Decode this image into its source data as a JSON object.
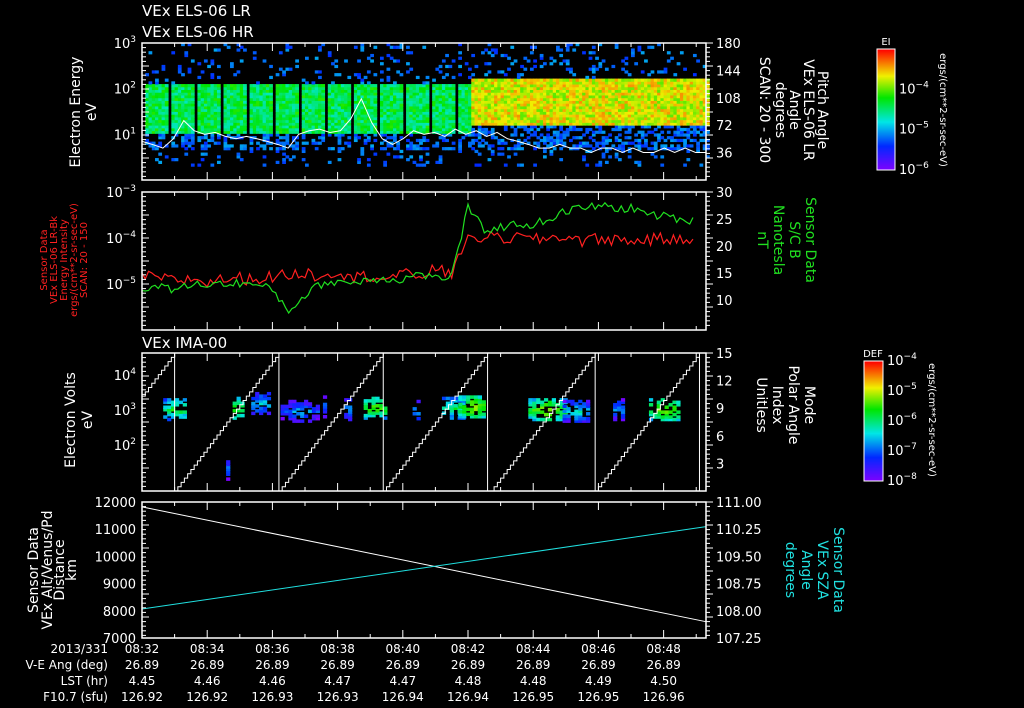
{
  "titles": [
    "VEx ELS-06 LR",
    "VEx ELS-06 HR"
  ],
  "chart_data": [
    {
      "type": "heatmap",
      "name": "ELS electron spectrogram",
      "ylabel_lines": [
        "Electron Energy",
        "eV"
      ],
      "y_scale": "log",
      "ylim": [
        1,
        1000
      ],
      "y_tick_exponents": [
        1,
        2,
        3
      ],
      "right_axis": {
        "label_lines": [
          "Pitch Angle",
          "VEx ELS-06 LR",
          "Angle",
          "degrees",
          "SCAN: 20 - 300"
        ],
        "ylim": [
          0,
          180
        ],
        "ticks": [
          "36",
          "72",
          "108",
          "144",
          "180"
        ]
      },
      "colorbar": {
        "title": "EI",
        "units": "ergs/(cm**2-sr-sec-eV)",
        "range_exponents": [
          -6,
          -3
        ],
        "tick_exponents": [
          -6,
          -5,
          -4
        ]
      },
      "intensity_regions": [
        {
          "from_min": 0,
          "to_min": 10,
          "band_eV": [
            10,
            120
          ],
          "level_exponent": -4.4
        },
        {
          "from_min": 10,
          "to_min": 17,
          "band_eV": [
            15,
            150
          ],
          "level_exponent": -3.7
        }
      ],
      "white_line_eV": [
        7,
        6,
        5,
        8,
        20,
        12,
        10,
        11,
        9,
        8,
        9,
        8,
        7,
        6,
        5,
        10,
        12,
        13,
        11,
        12,
        22,
        60,
        18,
        8,
        6,
        8,
        12,
        10,
        11,
        9,
        13,
        10,
        12,
        9,
        11,
        8,
        7,
        6,
        5,
        5,
        6,
        5,
        5,
        4,
        5,
        5,
        4,
        5,
        4,
        4,
        5,
        4,
        5,
        4,
        4
      ]
    },
    {
      "type": "line",
      "name": "Energy intensity and magnetic field",
      "x_minutes_step": 0.5,
      "left_axis": {
        "label_lines": [
          "Sensor Data",
          "VEx ELS-06 LR-Bk",
          "Energy Intensity",
          "ergs/(cm**2-sr-sec-eV)",
          "SCAN: 20 - 150"
        ],
        "scale": "log",
        "ylim": [
          1e-06,
          0.001
        ],
        "tick_exponents": [
          -5,
          -4,
          -3
        ],
        "color": "#ff2020"
      },
      "right_axis": {
        "label_lines": [
          "Sensor Data",
          "S/C B",
          "Nanotesla",
          "nT"
        ],
        "ylim": [
          4.5,
          30
        ],
        "ticks": [
          "10",
          "15",
          "20",
          "25",
          "30"
        ],
        "color": "#20e020"
      },
      "series": [
        {
          "name": "Energy Intensity",
          "color": "#ff2020",
          "values": [
            1.5e-05,
            1.4e-05,
            1.2e-05,
            1.3e-05,
            1.1e-05,
            1.3e-05,
            1.4e-05,
            1.3e-05,
            1.5e-05,
            1.6e-05,
            1.8e-05,
            1.5e-05,
            2e-05,
            1.4e-05,
            1.6e-05,
            1.3e-05,
            1.7e-05,
            1.5e-05,
            2.2e-05,
            1.6e-05,
            9e-05,
            0.00011,
            0.0001,
            0.000105,
            9.5e-05,
            0.0001,
            0.00011,
            9e-05,
            0.0001,
            9.5e-05,
            8.5e-05,
            9.5e-05,
            0.0001,
            9e-05,
            8.5e-05
          ]
        },
        {
          "name": "S/C B",
          "color": "#20e020",
          "values": [
            12.5,
            12.4,
            12,
            12.8,
            13,
            13,
            13.2,
            12.8,
            12,
            8,
            11,
            13,
            13.5,
            13.2,
            14,
            14,
            13.8,
            15,
            14,
            14.5,
            27,
            23,
            23.5,
            24,
            24,
            25,
            26.5,
            27,
            27.5,
            27,
            27,
            26,
            25.5,
            25,
            24.5
          ]
        }
      ]
    },
    {
      "type": "heatmap",
      "name": "IMA ion spectrogram",
      "title": "VEx IMA-00",
      "ylabel_lines": [
        "Electron Volts",
        "eV"
      ],
      "y_scale": "log",
      "ylim": [
        4.9,
        42000
      ],
      "y_tick_exponents": [
        2,
        3,
        4
      ],
      "right_axis": {
        "label_lines": [
          "Mode",
          "Polar Angle",
          "Index",
          "Unitless"
        ],
        "ylim": [
          0,
          15
        ],
        "ticks": [
          "3",
          "6",
          "9",
          "12",
          "15"
        ]
      },
      "colorbar": {
        "title": "DEF",
        "units": "ergs/(cm**2-sr-sec-eV)",
        "range_exponents": [
          -8,
          -4
        ],
        "tick_exponents": [
          -8,
          -7,
          -6,
          -5,
          -4
        ]
      },
      "mode_index_cycle_starts_min": [
        -2.2,
        1.0,
        4.2,
        7.4,
        10.7,
        13.9
      ],
      "mode_index_cycle_length_min": 3.2,
      "blobs": [
        {
          "t": 1.0,
          "eV": 1000,
          "level": -5.6,
          "spread": 0.35
        },
        {
          "t": 2.6,
          "eV": 20,
          "level": -6.8,
          "spread": 0.02
        },
        {
          "t": 2.9,
          "eV": 1100,
          "level": -5.4,
          "spread": 0.12
        },
        {
          "t": 3.6,
          "eV": 1500,
          "level": -6.3,
          "spread": 0.25
        },
        {
          "t": 4.8,
          "eV": 900,
          "level": -6.5,
          "spread": 0.55
        },
        {
          "t": 5.6,
          "eV": 1200,
          "level": -6.8,
          "spread": 0.05
        },
        {
          "t": 6.3,
          "eV": 1000,
          "level": -6.6,
          "spread": 0.1
        },
        {
          "t": 7.1,
          "eV": 1100,
          "level": -5.3,
          "spread": 0.3
        },
        {
          "t": 8.4,
          "eV": 900,
          "level": -6.7,
          "spread": 0.1
        },
        {
          "t": 9.5,
          "eV": 1100,
          "level": -5.8,
          "spread": 0.3
        },
        {
          "t": 10.1,
          "eV": 1200,
          "level": -5.0,
          "spread": 0.4
        },
        {
          "t": 12.4,
          "eV": 1000,
          "level": -5.0,
          "spread": 0.55
        },
        {
          "t": 13.3,
          "eV": 900,
          "level": -6.2,
          "spread": 0.4
        },
        {
          "t": 14.6,
          "eV": 1000,
          "level": -6.6,
          "spread": 0.15
        },
        {
          "t": 16.0,
          "eV": 1000,
          "level": -5.0,
          "spread": 0.45
        }
      ]
    },
    {
      "type": "line",
      "name": "Altitude and SZA",
      "left_axis": {
        "label_lines": [
          "Sensor Data",
          "VEx Alt/Venus/Pd",
          "Distance",
          "km"
        ],
        "ylim": [
          7000,
          12000
        ],
        "ticks": [
          "7000",
          "8000",
          "9000",
          "10000",
          "11000",
          "12000"
        ]
      },
      "right_axis": {
        "label_lines": [
          "Sensor Data",
          "VEx SZA",
          "Angle",
          "degrees"
        ],
        "ylim": [
          107.25,
          111.0
        ],
        "ticks": [
          "107.25",
          "108.00",
          "108.75",
          "109.50",
          "110.25",
          "111.00"
        ],
        "color": "#20e0e0"
      },
      "series": [
        {
          "name": "Distance",
          "color": "#ffffff",
          "x_min": [
            0,
            17.3
          ],
          "values": [
            11820,
            7600
          ]
        },
        {
          "name": "SZA",
          "color": "#20e0e0",
          "x_min": [
            0,
            17.3
          ],
          "values": [
            108.05,
            110.32
          ]
        }
      ]
    }
  ],
  "time_axis": {
    "xlim_min": [
      0,
      17.3
    ],
    "tick_minutes": [
      0,
      2,
      4,
      6,
      8,
      10,
      12,
      14,
      16
    ]
  },
  "ephemeris": {
    "row_labels": [
      "2013/331",
      "V-E Ang (deg)",
      "LST (hr)",
      "F10.7 (sfu)"
    ],
    "times": [
      "08:32",
      "08:34",
      "08:36",
      "08:38",
      "08:40",
      "08:42",
      "08:44",
      "08:46",
      "08:48"
    ],
    "ve_ang": [
      "26.89",
      "26.89",
      "26.89",
      "26.89",
      "26.89",
      "26.89",
      "26.89",
      "26.89",
      "26.89"
    ],
    "lst": [
      "4.45",
      "4.46",
      "4.46",
      "4.47",
      "4.47",
      "4.48",
      "4.48",
      "4.49",
      "4.50"
    ],
    "f107": [
      "126.92",
      "126.92",
      "126.93",
      "126.93",
      "126.94",
      "126.94",
      "126.95",
      "126.95",
      "126.96"
    ]
  }
}
